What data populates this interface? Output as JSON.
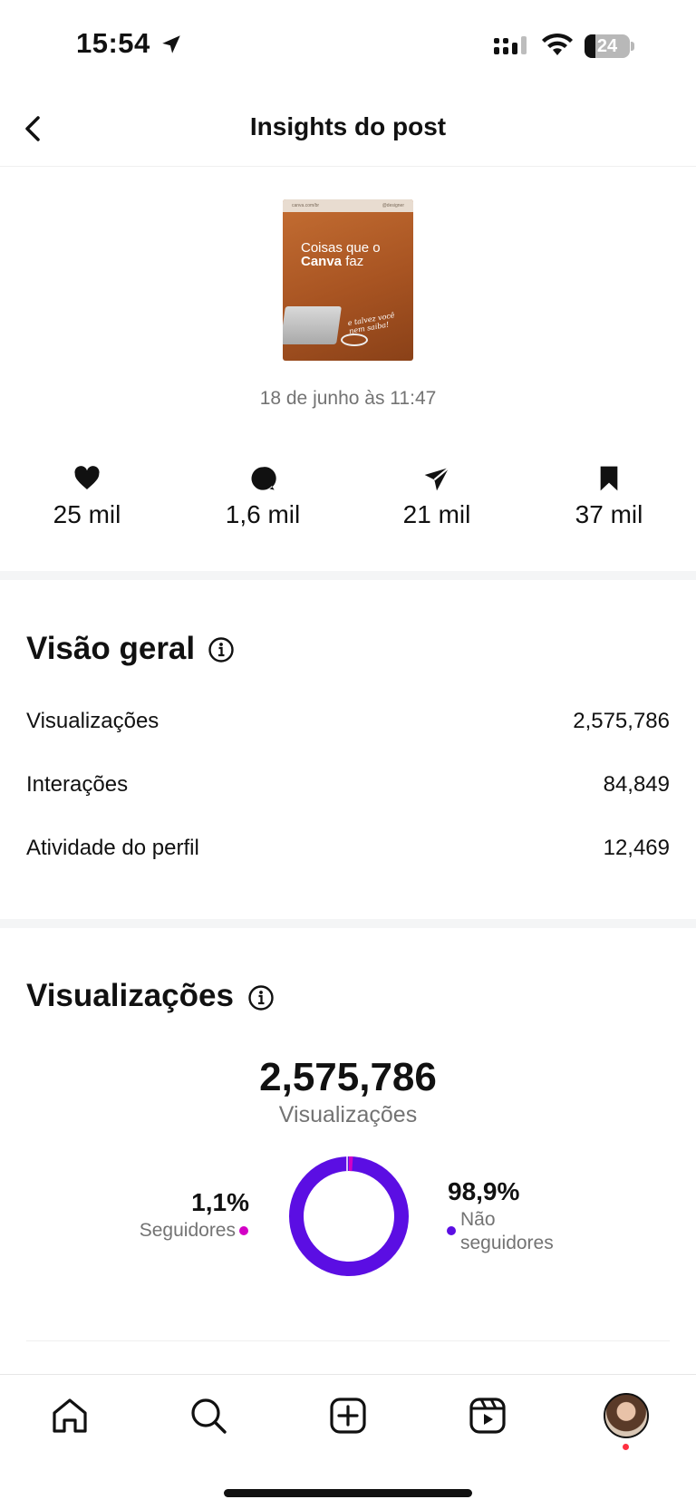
{
  "status_bar": {
    "time": "15:54",
    "battery": "24",
    "battery_level": 0.24
  },
  "header": {
    "title": "Insights do post"
  },
  "post": {
    "thumbnail": {
      "top_left": "canva.com/br",
      "top_right": "@designer",
      "line1": "Coisas que o",
      "line2_bold": "Canva",
      "line2_rest": " faz",
      "script": "e talvez você nem saiba!"
    },
    "date": "18 de junho às 11:47"
  },
  "stats": [
    {
      "icon": "heart-icon",
      "value": "25 mil"
    },
    {
      "icon": "comment-icon",
      "value": "1,6 mil"
    },
    {
      "icon": "share-icon",
      "value": "21 mil"
    },
    {
      "icon": "bookmark-icon",
      "value": "37 mil"
    }
  ],
  "overview": {
    "title": "Visão geral",
    "rows": [
      {
        "label": "Visualizações",
        "value": "2,575,786"
      },
      {
        "label": "Interações",
        "value": "84,849"
      },
      {
        "label": "Atividade do perfil",
        "value": "12,469"
      }
    ]
  },
  "views": {
    "title": "Visualizações",
    "total": "2,575,786",
    "total_label": "Visualizações",
    "followers_pct": "1,1%",
    "followers_label": "Seguidores",
    "followers_fraction": 0.011,
    "followers_color": "#d300c5",
    "non_followers_pct": "98,9%",
    "non_followers_label_1": "Não",
    "non_followers_label_2": "seguidores",
    "non_followers_color": "#5b0ee3"
  },
  "tab_bar": {
    "tabs": [
      "home-icon",
      "search-icon",
      "create-icon",
      "reels-icon",
      "profile-avatar"
    ]
  }
}
